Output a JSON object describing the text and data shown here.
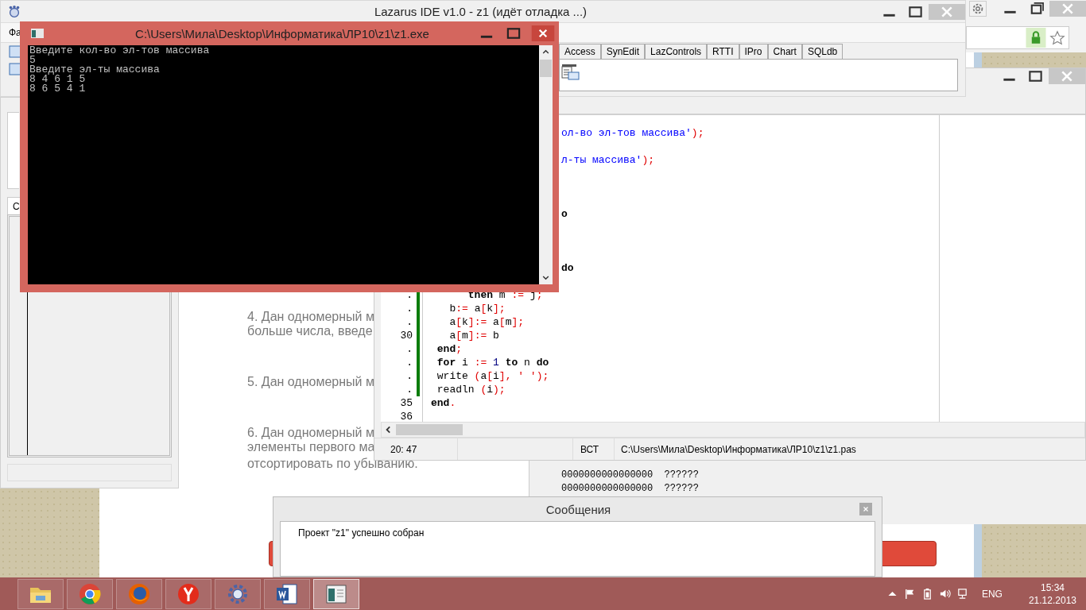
{
  "ide": {
    "title": "Lazarus IDE v1.0 - z1 (идёт отладка ...)",
    "menu": [
      "Фа"
    ],
    "palette_tabs": [
      {
        "label": "Access",
        "selected": false
      },
      {
        "label": "SynEdit",
        "selected": false
      },
      {
        "label": "LazControls",
        "selected": false
      },
      {
        "label": "RTTI",
        "selected": false
      },
      {
        "label": "IPro",
        "selected": false
      },
      {
        "label": "Chart",
        "selected": false
      },
      {
        "label": "SQLdb",
        "selected": false
      }
    ]
  },
  "inspector": {
    "tabs": [
      {
        "label": "С",
        "selected": true
      }
    ]
  },
  "browser": {
    "paragraphs": [
      [
        "4. Дан одномерный м",
        "больше числа, введе"
      ],
      [
        "5. Дан одномерный м"
      ],
      [
        "6. Дан одномерный м",
        "элементы первого ма",
        "отсортировать по убыванию."
      ]
    ]
  },
  "editor": {
    "partial_lines": [
      [
        {
          "kind": "str",
          "text": "ол-во эл-тов массива'"
        },
        {
          "kind": "sym",
          "text": ");"
        }
      ],
      [
        {
          "kind": "str",
          "text": "л-ты массива'"
        },
        {
          "kind": "sym",
          "text": ");"
        }
      ],
      [
        {
          "kind": "kw",
          "text": "o"
        }
      ],
      [
        {
          "kind": "kw",
          "text": "do"
        }
      ]
    ],
    "lines": [
      {
        "gutter": ".",
        "modified": true,
        "tokens": [
          {
            "kind": "kw",
            "text": "      then"
          },
          {
            "kind": "id",
            "text": " m "
          },
          {
            "kind": "sym",
            "text": ":="
          },
          {
            "kind": "id",
            "text": " j"
          },
          {
            "kind": "sym",
            "text": ";"
          }
        ]
      },
      {
        "gutter": ".",
        "modified": true,
        "tokens": [
          {
            "kind": "id",
            "text": "   b"
          },
          {
            "kind": "sym",
            "text": ":="
          },
          {
            "kind": "id",
            "text": " a"
          },
          {
            "kind": "sym",
            "text": "["
          },
          {
            "kind": "id",
            "text": "k"
          },
          {
            "kind": "sym",
            "text": "];"
          }
        ]
      },
      {
        "gutter": ".",
        "modified": true,
        "tokens": [
          {
            "kind": "id",
            "text": "   a"
          },
          {
            "kind": "sym",
            "text": "["
          },
          {
            "kind": "id",
            "text": "k"
          },
          {
            "kind": "sym",
            "text": "]:="
          },
          {
            "kind": "id",
            "text": " a"
          },
          {
            "kind": "sym",
            "text": "["
          },
          {
            "kind": "id",
            "text": "m"
          },
          {
            "kind": "sym",
            "text": "];"
          }
        ]
      },
      {
        "gutter": "30",
        "modified": true,
        "tokens": [
          {
            "kind": "id",
            "text": "   a"
          },
          {
            "kind": "sym",
            "text": "["
          },
          {
            "kind": "id",
            "text": "m"
          },
          {
            "kind": "sym",
            "text": "]:="
          },
          {
            "kind": "id",
            "text": " b"
          }
        ]
      },
      {
        "gutter": ".",
        "modified": true,
        "tokens": [
          {
            "kind": "kw",
            "text": " end"
          },
          {
            "kind": "sym",
            "text": ";"
          }
        ]
      },
      {
        "gutter": ".",
        "modified": true,
        "tokens": [
          {
            "kind": "kw",
            "text": " for"
          },
          {
            "kind": "id",
            "text": " i "
          },
          {
            "kind": "sym",
            "text": ":="
          },
          {
            "kind": "num",
            "text": " 1"
          },
          {
            "kind": "kw",
            "text": " to"
          },
          {
            "kind": "id",
            "text": " n "
          },
          {
            "kind": "kw",
            "text": "do"
          }
        ]
      },
      {
        "gutter": ".",
        "modified": true,
        "tokens": [
          {
            "kind": "id",
            "text": " write "
          },
          {
            "kind": "sym",
            "text": "("
          },
          {
            "kind": "id",
            "text": "a"
          },
          {
            "kind": "sym",
            "text": "["
          },
          {
            "kind": "id",
            "text": "i"
          },
          {
            "kind": "sym",
            "text": "], ' ');"
          }
        ]
      },
      {
        "gutter": ".",
        "modified": true,
        "tokens": [
          {
            "kind": "id",
            "text": " readln "
          },
          {
            "kind": "sym",
            "text": "("
          },
          {
            "kind": "id",
            "text": "i"
          },
          {
            "kind": "sym",
            "text": ");"
          }
        ]
      },
      {
        "gutter": "35",
        "modified": false,
        "tokens": [
          {
            "kind": "kw",
            "text": "end"
          },
          {
            "kind": "sym",
            "text": "."
          }
        ]
      },
      {
        "gutter": "36",
        "modified": false
      }
    ],
    "status": {
      "position": "20: 47",
      "mode": "ВСТ",
      "path": "C:\\Users\\Мила\\Desktop\\Информатика\\ЛР10\\z1\\z1.pas"
    }
  },
  "assembler": {
    "lines": [
      "0000000000000000  ??????",
      "0000000000000000  ??????"
    ]
  },
  "console": {
    "title": "C:\\Users\\Мила\\Desktop\\Информатика\\ЛР10\\z1\\z1.exe",
    "lines": [
      "Введите кол-во эл-тов массива",
      "5",
      "Введите эл-ты массива",
      "8 4 6 1 5",
      "8 6 5 4 1"
    ]
  },
  "messages": {
    "title": "Сообщения",
    "items": [
      "Проект \"z1\" успешно собран"
    ]
  },
  "taskbar": {
    "apps": [
      {
        "kind": "folder",
        "selected": false
      },
      {
        "kind": "chrome",
        "selected": false
      },
      {
        "kind": "firefox",
        "selected": false
      },
      {
        "kind": "yandex",
        "selected": false
      },
      {
        "kind": "lazarus",
        "selected": false
      },
      {
        "kind": "word",
        "selected": false
      },
      {
        "kind": "console",
        "selected": true
      }
    ],
    "language": "ENG",
    "time": "15:34",
    "date": "21.12.2013"
  }
}
